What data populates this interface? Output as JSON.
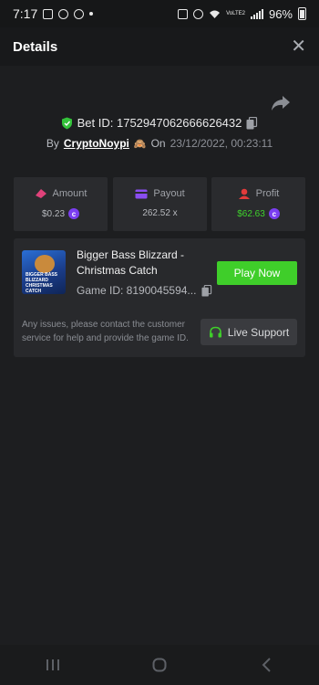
{
  "status_bar": {
    "time": "7:17",
    "network": "VoLTE2",
    "battery": "96%"
  },
  "header": {
    "title": "Details",
    "close_symbol": "✕"
  },
  "bet": {
    "id_label": "Bet ID: 1752947062666626432",
    "by_label": "By",
    "username": "CryptoNoypi",
    "on_label": "On",
    "date": "23/12/2022, 00:23:11"
  },
  "stats": {
    "amount": {
      "label": "Amount",
      "value": "$0.23"
    },
    "payout": {
      "label": "Payout",
      "value": "262.52 x"
    },
    "profit": {
      "label": "Profit",
      "value": "$62.63"
    }
  },
  "game": {
    "title": "Bigger Bass Blizzard - Christmas Catch",
    "id_label": "Game ID: 8190045594...",
    "play_label": "Play Now",
    "thumb_text": "BIGGER BASS BLIZZARD CHRISTMAS CATCH"
  },
  "support": {
    "text": "Any issues, please contact the customer service for help and provide the game ID.",
    "button_label": "Live Support"
  },
  "colors": {
    "accent_green": "#3fce2a",
    "coin_purple": "#7b3ef0",
    "amount_icon": "#e0427a",
    "payout_icon": "#8a4df0",
    "profit_icon": "#e23b3b"
  }
}
